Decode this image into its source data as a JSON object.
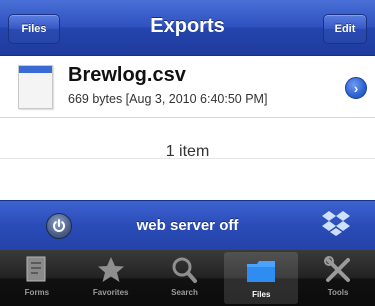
{
  "navbar": {
    "title": "Exports",
    "back_label": "Files",
    "edit_label": "Edit"
  },
  "files": [
    {
      "name": "Brewlog.csv",
      "meta": "669 bytes  [Aug 3, 2010 6:40:50 PM]"
    }
  ],
  "list": {
    "count_text": "1 item"
  },
  "server": {
    "status_text": "web server off",
    "power_icon": "power-icon",
    "dropbox_icon": "dropbox-icon"
  },
  "tabs": [
    {
      "label": "Forms",
      "icon": "forms-icon"
    },
    {
      "label": "Favorites",
      "icon": "star-icon"
    },
    {
      "label": "Search",
      "icon": "search-icon"
    },
    {
      "label": "Files",
      "icon": "folder-icon"
    },
    {
      "label": "Tools",
      "icon": "tools-icon"
    }
  ],
  "colors": {
    "navbar_blue": "#2f52c0",
    "server_bar_blue": "#2a4cb8",
    "tabbar_dark": "#1a1a1a",
    "disclosure_blue": "#2e62d2"
  }
}
